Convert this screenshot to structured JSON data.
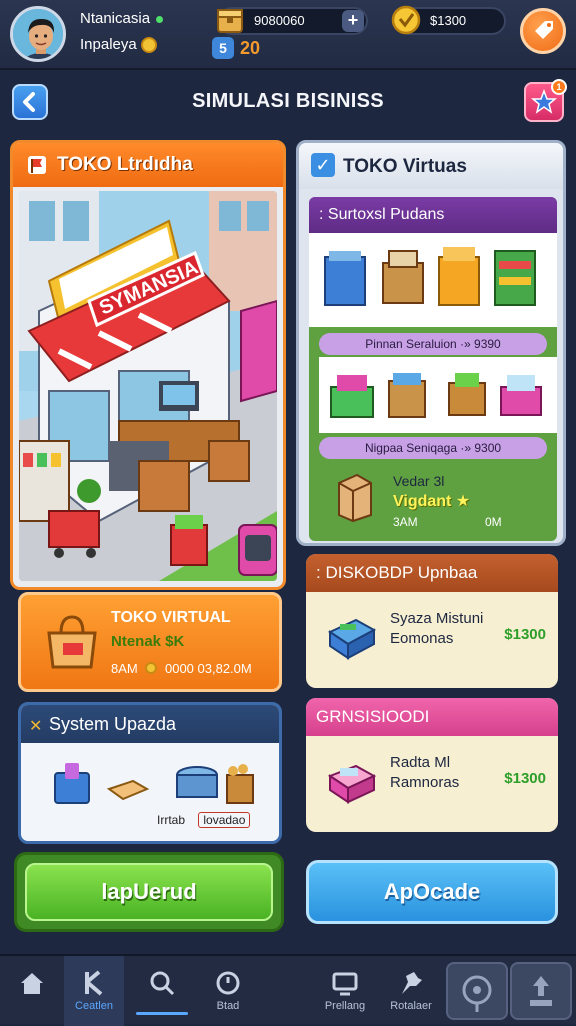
{
  "player": {
    "name": "Ntanicasia",
    "subtitle": "Inpaleya",
    "resource_value": "9080060",
    "coins_value": "$1300",
    "level": "20"
  },
  "header": {
    "title": "SIMULASI BISINISS",
    "notification_count": "1"
  },
  "left_panel": {
    "title": "TOKO Ltrdıdha",
    "store_sign": "SYMANSIA"
  },
  "virtual_card": {
    "title": "TOKO VIRTUAL",
    "subtitle": "Ntenak $K",
    "meta_left": "8AM",
    "meta_right": "0000 03,82.0M"
  },
  "system_update": {
    "title": "System Upazda",
    "tag_1": "Irrtab",
    "tag_2": "lovadao"
  },
  "left_button": {
    "label": "lapUerud"
  },
  "right_panel": {
    "title": "TOKO Virtuas",
    "section_title": ": Surtoxsl Pudans",
    "price_row_1": "Pinnan Seraluion ·» 9390",
    "price_row_2": "Nigpaa Seniqaga ·» 9300",
    "footer_line_1": "Vedar 3l",
    "footer_line_2": "Vigdant ★",
    "footer_meta_left": "3AM",
    "footer_meta_right": "0M"
  },
  "discount_card": {
    "title": ": DISKOBDP Upnbaa",
    "line_1": "Syaza Mistuni",
    "line_2": "Eomonas",
    "price": "$1300"
  },
  "promo_card": {
    "title": "GRNSISIOODI",
    "line_1": "Radta Ml",
    "line_2": "Ramnoras",
    "price": "$1300"
  },
  "right_button": {
    "label": "ApOcade"
  },
  "bottom_nav": {
    "items": [
      {
        "label": "",
        "icon": "home-icon"
      },
      {
        "label": "Ceatlen",
        "icon": "tools-icon"
      },
      {
        "label": "",
        "icon": "search-icon"
      },
      {
        "label": "Btad",
        "icon": "clock-icon"
      },
      {
        "label": "Prellang",
        "icon": "monitor-icon"
      },
      {
        "label": "Rotalaer",
        "icon": "puzzle-icon"
      },
      {
        "label": "",
        "icon": "pin-icon"
      },
      {
        "label": "",
        "icon": "upload-icon"
      }
    ]
  },
  "colors": {
    "background": "#1d2740",
    "orange_accent": "#f07714",
    "purple_section": "#6a3195",
    "green_button": "#4ab324",
    "blue_button": "#2a92df",
    "discount_header": "#b7562a",
    "promo_header": "#e0509a",
    "price_green": "#2e9e2a"
  }
}
